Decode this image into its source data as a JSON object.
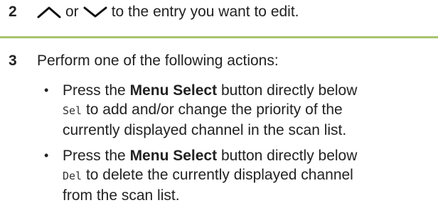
{
  "step2": {
    "number": "2",
    "connector": "or",
    "suffix": "to the entry you want to edit.",
    "up_icon": "up-caret-icon",
    "down_icon": "down-caret-icon"
  },
  "step3": {
    "number": "3",
    "text": "Perform one of the following actions:",
    "bullets": [
      {
        "prefix": "Press the",
        "button_name": "Menu Select",
        "after_button": "button directly below",
        "code": "Sel",
        "after_code": "to add and/or change the priority of the",
        "continuation": "currently displayed channel in the scan list."
      },
      {
        "prefix": "Press the",
        "button_name": "Menu Select",
        "after_button": "button directly below",
        "code": "Del",
        "after_code": "to delete the currently displayed channel",
        "continuation": "from the scan list."
      }
    ]
  },
  "colors": {
    "divider": "#a6c46f",
    "text": "#222222"
  }
}
